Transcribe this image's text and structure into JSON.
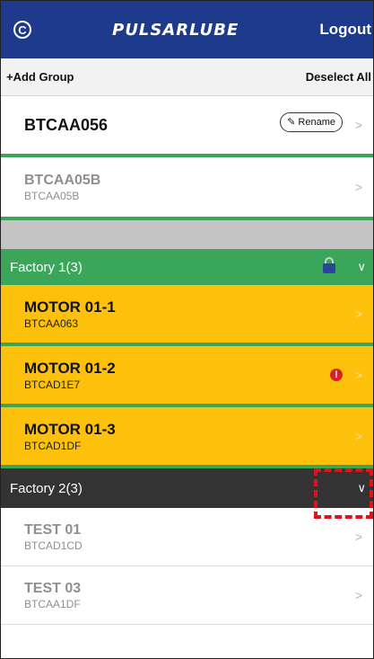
{
  "header": {
    "logo": "PULSARLUBE",
    "logout": "Logout",
    "left_icon": "refresh-c-icon"
  },
  "toolbar": {
    "add_group": "+Add Group",
    "deselect_all": "Deselect All"
  },
  "groups": [
    {
      "title": "BTCAA056",
      "rename": "Rename"
    }
  ],
  "devices": {
    "unassigned": [
      {
        "name": "BTCAA05B",
        "id": "BTCAA05B"
      }
    ],
    "factory1": [
      {
        "name": "MOTOR 01-1",
        "id": "BTCAA063"
      },
      {
        "name": "MOTOR 01-2",
        "id": "BTCAD1E7"
      },
      {
        "name": "MOTOR 01-3",
        "id": "BTCAD1DF"
      }
    ],
    "factory2": [
      {
        "name": "TEST 01",
        "id": "BTCAD1CD"
      },
      {
        "name": "TEST 03",
        "id": "BTCAA1DF"
      }
    ]
  },
  "sections": {
    "factory1": "Factory 1(3)",
    "factory2": "Factory 2(3)"
  },
  "colors": {
    "header_blue": "#1d3a8c",
    "factory1_green": "#3aa65a",
    "factory2_dark": "#333333",
    "device_yellow": "#fec10b",
    "alert_red": "#d6232a",
    "highlight_red": "#e0131b"
  }
}
